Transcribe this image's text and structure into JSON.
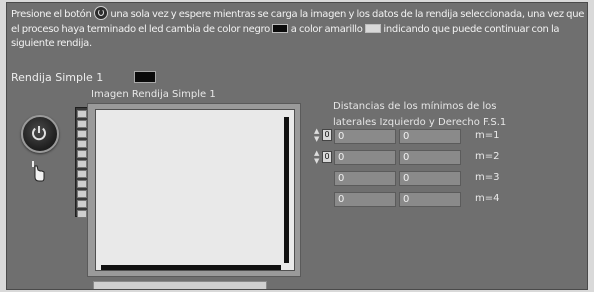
{
  "instructions": {
    "part1": "Presione el botón",
    "part2": "una sola vez y espere mientras se carga la imagen y los datos de la rendija seleccionada, una vez que el proceso haya terminado el led cambia de color negro",
    "part3": "a color amarillo",
    "part4": "indicando que puede continuar con la siguiente rendija."
  },
  "rendija_label": "Rendija Simple 1",
  "image_title": "Imagen Rendija Simple 1",
  "distances": {
    "title": "Distancias de los mínimos de los laterales Izquierdo y Derecho F.S.1",
    "index_left": "0",
    "index_right": "0",
    "rows": [
      {
        "left": "0",
        "right": "0",
        "label": "m=1"
      },
      {
        "left": "0",
        "right": "0",
        "label": "m=2"
      },
      {
        "left": "0",
        "right": "0",
        "label": "m=3"
      },
      {
        "left": "0",
        "right": "0",
        "label": "m=4"
      }
    ]
  },
  "colors": {
    "panel_bg": "#6f6f6f",
    "led_off": "#0a0a0a",
    "led_on": "#d9d9d9"
  },
  "icons": [
    "power-icon",
    "hand-pointer-icon",
    "led-indicator"
  ]
}
